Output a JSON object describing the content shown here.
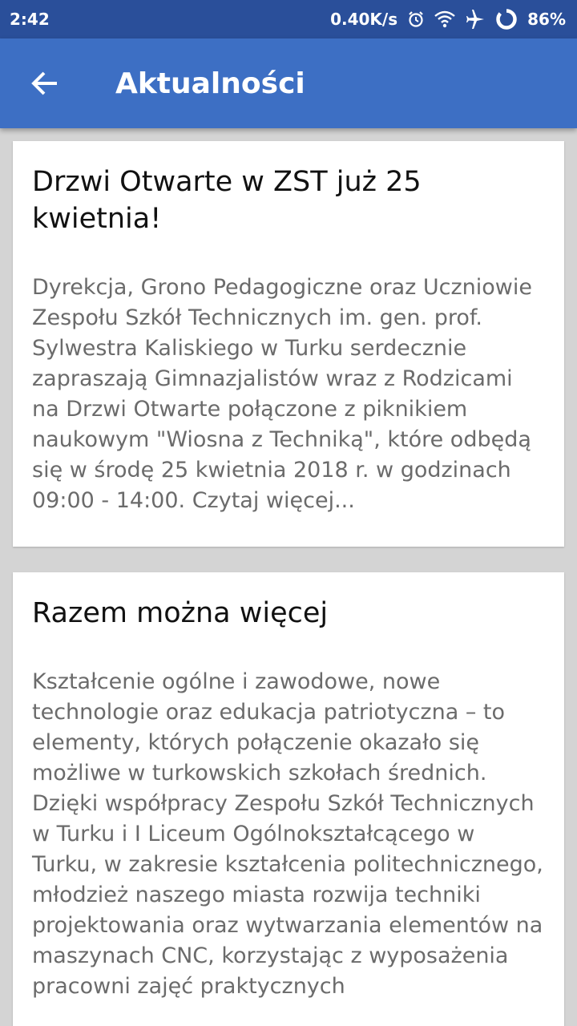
{
  "status_bar": {
    "time": "2:42",
    "net_speed": "0.40K/s",
    "battery": "86%",
    "icons": [
      "alarm-icon",
      "wifi-icon",
      "airplane-icon",
      "battery-ring-icon"
    ]
  },
  "app_bar": {
    "title": "Aktualności",
    "back_icon": "arrow-back-icon"
  },
  "colors": {
    "status_bar": "#2a4f9a",
    "app_bar": "#3d6fc4",
    "background": "#d4d4d4",
    "card": "#ffffff",
    "title_text": "#111111",
    "body_text": "#6b6b6b"
  },
  "news": [
    {
      "title": "Drzwi Otwarte w ZST już 25 kwietnia!",
      "body": "Dyrekcja, Grono Pedagogiczne oraz Uczniowie Zespołu Szkół Technicznych im. gen. prof. Sylwestra Kaliskiego w Turku serdecznie zapraszają Gimnazjalistów wraz z Rodzicami na Drzwi Otwarte połączone z piknikiem naukowym \"Wiosna z Techniką\", które odbędą się w środę 25 kwietnia 2018 r. w godzinach 09:00 - 14:00. Czytaj więcej..."
    },
    {
      "title": "Razem można więcej",
      "body": "Kształcenie ogólne i zawodowe, nowe technologie oraz edukacja patriotyczna – to elementy, których połączenie okazało się możliwe w turkowskich szkołach średnich. Dzięki współpracy Zespołu Szkół Technicznych w Turku i I Liceum Ogólnokształcącego w Turku, w zakresie kształcenia politechnicznego, młodzież naszego miasta rozwija techniki projektowania oraz wytwarzania elementów na maszynach CNC, korzystając z wyposażenia pracowni zajęć praktycznych"
    }
  ]
}
